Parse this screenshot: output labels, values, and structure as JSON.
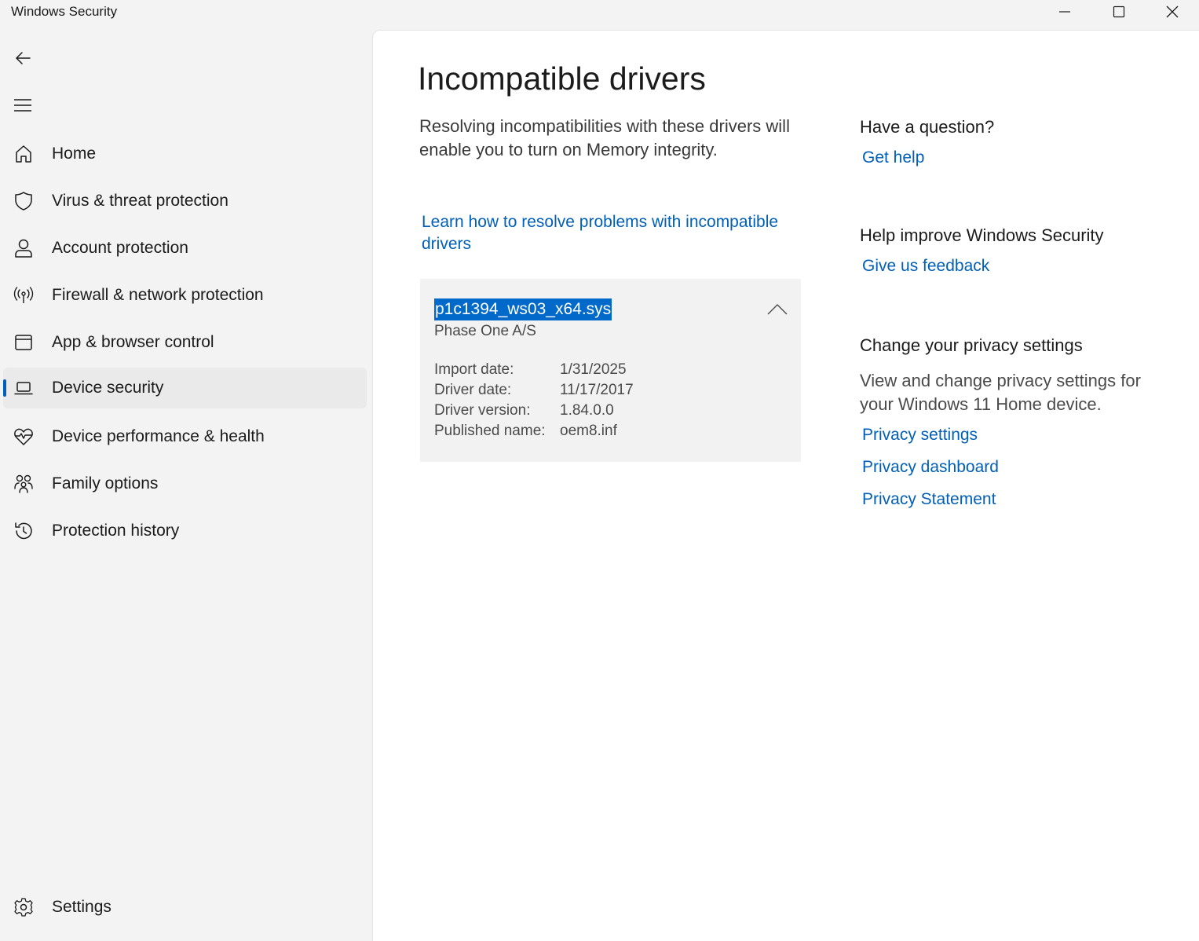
{
  "window": {
    "title": "Windows Security",
    "controls": {
      "minimize": "minimize-icon",
      "maximize": "maximize-icon",
      "close": "close-icon"
    }
  },
  "sidebar": {
    "back_icon": "back-arrow-icon",
    "menu_icon": "hamburger-menu-icon",
    "items": [
      {
        "label": "Home",
        "icon": "home-icon"
      },
      {
        "label": "Virus & threat protection",
        "icon": "shield-icon"
      },
      {
        "label": "Account protection",
        "icon": "person-icon"
      },
      {
        "label": "Firewall & network protection",
        "icon": "antenna-icon"
      },
      {
        "label": "App & browser control",
        "icon": "app-window-icon"
      },
      {
        "label": "Device security",
        "icon": "laptop-icon",
        "selected": true
      },
      {
        "label": "Device performance & health",
        "icon": "heart-pulse-icon"
      },
      {
        "label": "Family options",
        "icon": "family-icon"
      },
      {
        "label": "Protection history",
        "icon": "history-icon"
      }
    ],
    "settings": {
      "label": "Settings",
      "icon": "gear-icon"
    }
  },
  "main": {
    "title": "Incompatible drivers",
    "description": "Resolving incompatibilities with these drivers will enable you to turn on Memory integrity.",
    "learn_link": "Learn how to resolve problems with incompatible drivers",
    "driver": {
      "name": "p1c1394_ws03_x64.sys",
      "vendor": "Phase One A/S",
      "details": [
        {
          "key": "Import date:",
          "value": "1/31/2025"
        },
        {
          "key": "Driver date:",
          "value": "11/17/2017"
        },
        {
          "key": "Driver version:",
          "value": "1.84.0.0"
        },
        {
          "key": "Published name:",
          "value": "oem8.inf"
        }
      ]
    }
  },
  "aside": {
    "question": {
      "heading": "Have a question?",
      "link": "Get help"
    },
    "improve": {
      "heading": "Help improve Windows Security",
      "link": "Give us feedback"
    },
    "privacy": {
      "heading": "Change your privacy settings",
      "text": "View and change privacy settings for your Windows 11 Home device.",
      "links": [
        "Privacy settings",
        "Privacy dashboard",
        "Privacy Statement"
      ]
    }
  },
  "colors": {
    "accent": "#005fb8",
    "selection": "#0069c9",
    "card": "#f2f2f2",
    "sidebar_bg": "#f3f3f3"
  }
}
